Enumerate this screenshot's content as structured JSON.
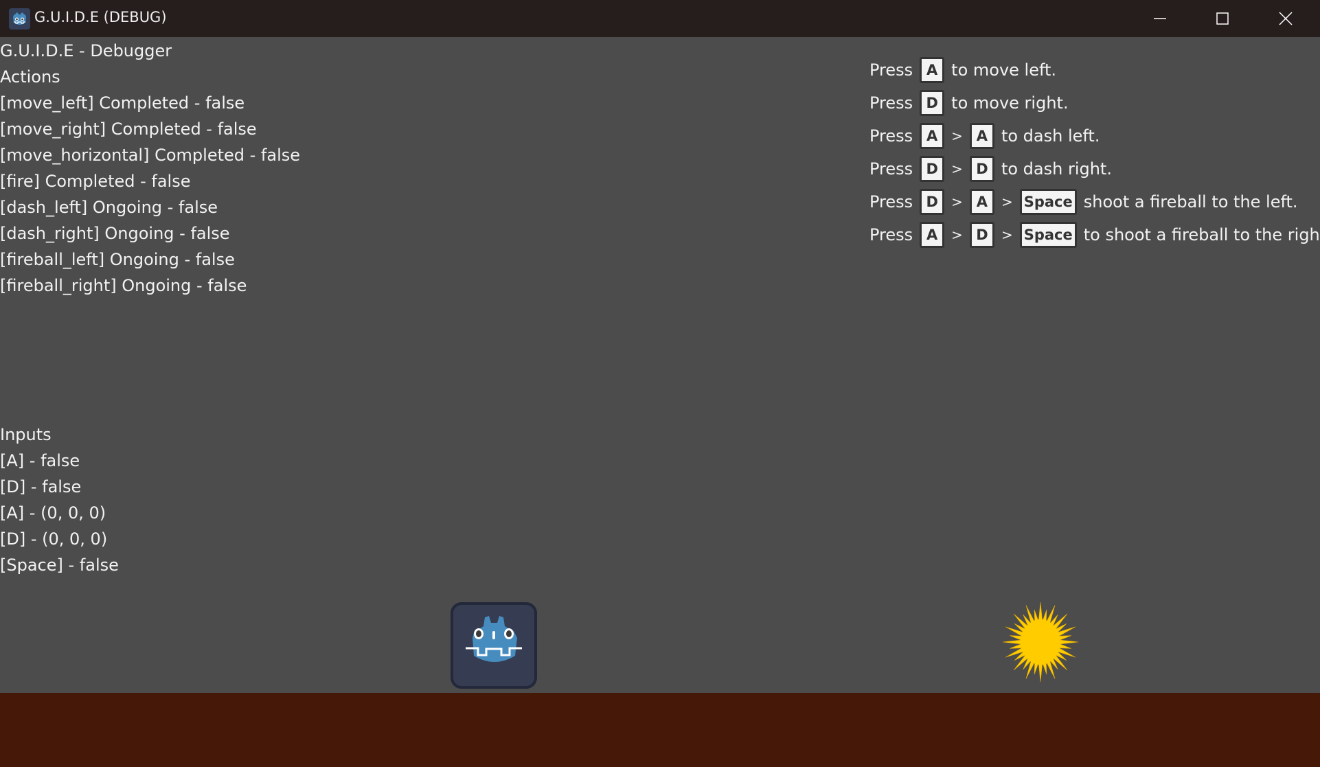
{
  "window": {
    "title": "G.U.I.D.E (DEBUG)"
  },
  "debugger": {
    "heading": "G.U.I.D.E - Debugger",
    "actions_label": "Actions",
    "actions": [
      "[move_left] Completed - false",
      "[move_right] Completed - false",
      "[move_horizontal] Completed - false",
      "[fire] Completed - false",
      "[dash_left] Ongoing - false",
      "[dash_right] Ongoing - false",
      "[fireball_left] Ongoing - false",
      "[fireball_right] Ongoing - false"
    ],
    "inputs_label": "Inputs",
    "inputs": [
      "[A] - false",
      "[D] - false",
      "[A] - (0, 0, 0)",
      "[D] - (0, 0, 0)",
      "[Space] - false"
    ]
  },
  "hints": {
    "press": "Press",
    "sep": ">",
    "rows": [
      {
        "keys": [
          "A"
        ],
        "text": "to move left."
      },
      {
        "keys": [
          "D"
        ],
        "text": "to move right."
      },
      {
        "keys": [
          "A",
          "A"
        ],
        "text": "to dash left."
      },
      {
        "keys": [
          "D",
          "D"
        ],
        "text": "to dash right."
      },
      {
        "keys": [
          "D",
          "A",
          "Space"
        ],
        "text": "shoot a fireball to the left."
      },
      {
        "keys": [
          "A",
          "D",
          "Space"
        ],
        "text": "to shoot a fireball to the right."
      }
    ]
  },
  "colors": {
    "background": "#4c4c4c",
    "ground": "#461808",
    "sun": "#ffcc00",
    "godot": "#478cbf"
  }
}
